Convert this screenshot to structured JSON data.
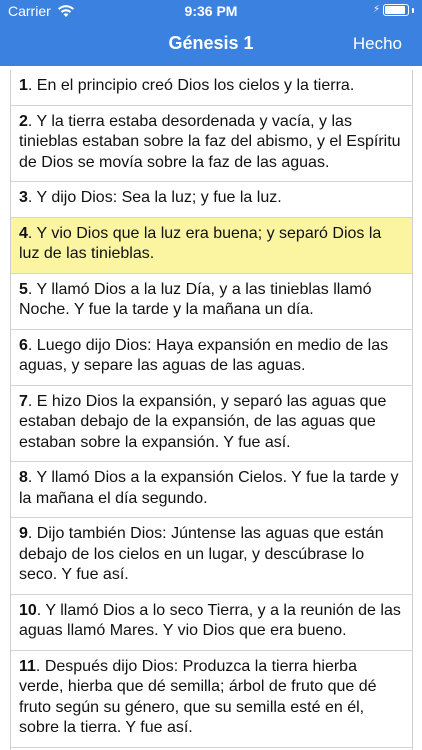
{
  "status": {
    "carrier": "Carrier",
    "time": "9:36 PM"
  },
  "nav": {
    "title": "Génesis 1",
    "done_label": "Hecho"
  },
  "verses": [
    {
      "num": "1",
      "text": ". En el principio creó Dios los cielos y la tierra."
    },
    {
      "num": "2",
      "text": ". Y la tierra estaba desordenada y vacía, y las tinieblas estaban sobre la faz del abismo, y el Espíritu de Dios se movía sobre la faz de las aguas."
    },
    {
      "num": "3",
      "text": ". Y dijo Dios: Sea la luz; y fue la luz."
    },
    {
      "num": "4",
      "text": ". Y vio Dios que la luz era buena; y separó Dios la luz de las tinieblas."
    },
    {
      "num": "5",
      "text": ". Y llamó Dios a la luz Día, y a las tinieblas llamó Noche. Y fue la tarde y la mañana un día."
    },
    {
      "num": "6",
      "text": ". Luego dijo Dios: Haya expansión en medio de las aguas, y separe las aguas de las aguas."
    },
    {
      "num": "7",
      "text": ". E hizo Dios la expansión, y separó las aguas que estaban debajo de la expansión, de las aguas que estaban sobre la expansión. Y fue así."
    },
    {
      "num": "8",
      "text": ". Y llamó Dios a la expansión Cielos. Y fue la tarde y la mañana el día segundo."
    },
    {
      "num": "9",
      "text": ". Dijo también Dios: Júntense las aguas que están debajo de los cielos en un lugar, y descúbrase lo seco. Y fue así."
    },
    {
      "num": "10",
      "text": ". Y llamó Dios a lo seco Tierra, y a la reunión de las aguas llamó Mares. Y vio Dios que era bueno."
    },
    {
      "num": "11",
      "text": ". Después dijo Dios: Produzca la tierra hierba verde, hierba que dé semilla; árbol de fruto que dé fruto según su género, que su semilla esté en él, sobre la tierra. Y fue así."
    }
  ],
  "colors": {
    "bar": "#3b82e0",
    "highlight": "#fbf5a2"
  }
}
